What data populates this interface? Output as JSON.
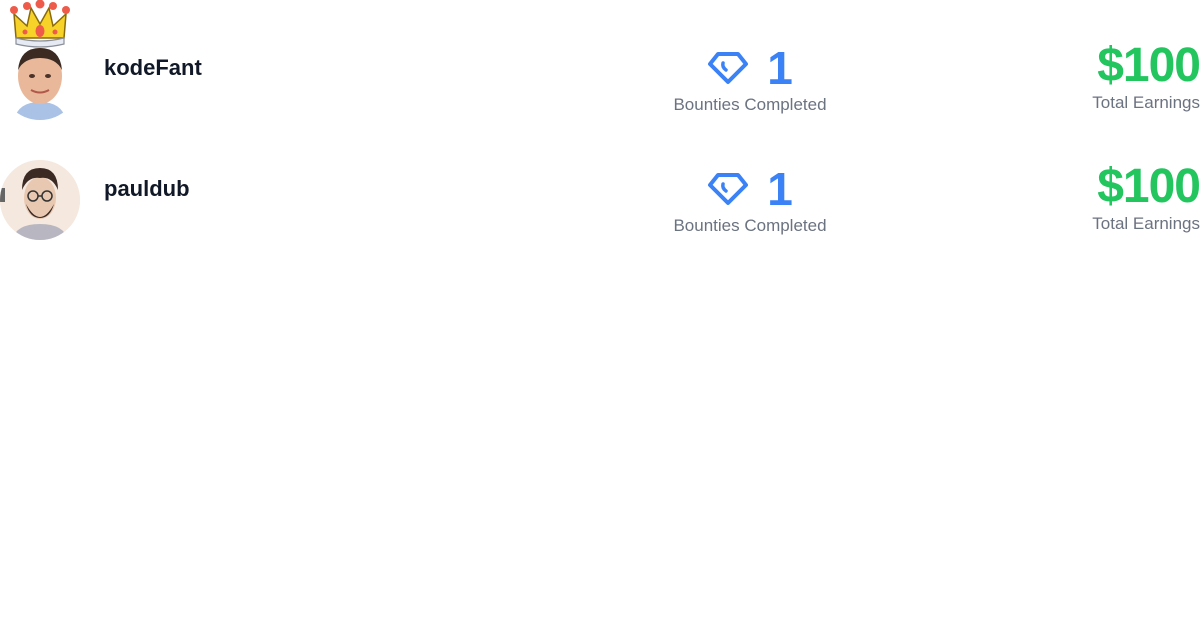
{
  "leaderboard": [
    {
      "username": "kodeFant",
      "is_top": true,
      "badge_icon": "crown-icon",
      "bounties_completed": "1",
      "bounties_label": "Bounties Completed",
      "total_earnings": "$100",
      "earnings_label": "Total Earnings"
    },
    {
      "username": "pauldub",
      "is_top": false,
      "bounties_completed": "1",
      "bounties_label": "Bounties Completed",
      "total_earnings": "$100",
      "earnings_label": "Total Earnings"
    }
  ],
  "colors": {
    "bounty_accent": "#3b82f6",
    "earnings_accent": "#22c55e",
    "username": "#111827",
    "label": "#6b7280"
  }
}
